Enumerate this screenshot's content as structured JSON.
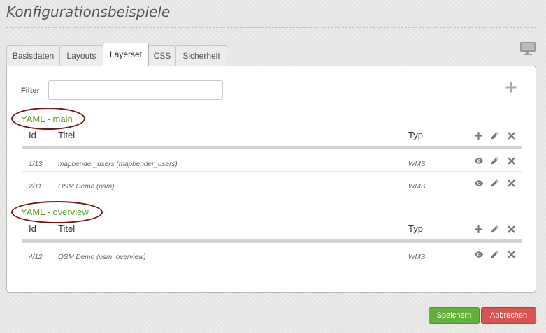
{
  "page": {
    "title": "Konfigurationsbeispiele"
  },
  "tabs": [
    {
      "label": "Basisdaten",
      "active": false
    },
    {
      "label": "Layouts",
      "active": false
    },
    {
      "label": "Layerset",
      "active": true
    },
    {
      "label": "CSS",
      "active": false
    },
    {
      "label": "Sicherheit",
      "active": false
    }
  ],
  "filter": {
    "label": "Filter",
    "value": "",
    "placeholder": ""
  },
  "columns": {
    "id": "Id",
    "title": "Titel",
    "type": "Typ"
  },
  "layersets": [
    {
      "name": "YAML - main",
      "rows": [
        {
          "id": "1/13",
          "title": "mapbender_users (mapbender_users)",
          "type": "WMS"
        },
        {
          "id": "2/11",
          "title": "OSM Demo (osm)",
          "type": "WMS"
        }
      ]
    },
    {
      "name": "YAML - overview",
      "rows": [
        {
          "id": "4/12",
          "title": "OSM Demo (osm_overview)",
          "type": "WMS"
        }
      ]
    }
  ],
  "buttons": {
    "save": "Speichern",
    "cancel": "Abbrechen"
  },
  "colors": {
    "accent_green": "#5aa02c",
    "save_button": "#61b13c",
    "cancel_button": "#d9534f",
    "highlight_oval": "#7a1418"
  },
  "icons": {
    "display": "monitor-icon",
    "add": "plus-icon",
    "edit": "pencil-icon",
    "delete": "close-icon",
    "visibility": "eye-icon"
  }
}
